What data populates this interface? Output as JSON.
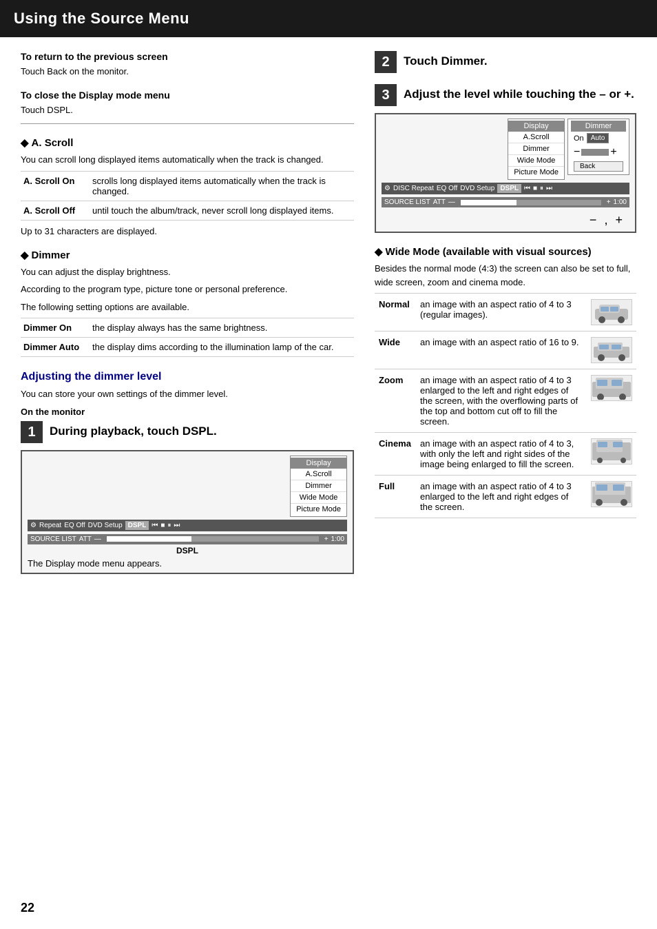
{
  "header": {
    "title": "Using the Source Menu"
  },
  "return_section": {
    "title": "To return to the previous screen",
    "body": "Touch Back on the monitor."
  },
  "close_section": {
    "title": "To close the Display mode menu",
    "body": "Touch DSPL."
  },
  "scroll_section": {
    "diamond_title": "A. Scroll",
    "body": "You can scroll long displayed items automatically when the track is changed.",
    "table": [
      {
        "term": "A. Scroll On",
        "definition": "scrolls long displayed items automatically when the track is changed."
      },
      {
        "term": "A. Scroll Off",
        "definition": "until touch the album/track, never scroll long displayed items."
      }
    ],
    "note": "Up to 31 characters are displayed."
  },
  "dimmer_section": {
    "diamond_title": "Dimmer",
    "body": "You can adjust the display brightness.",
    "body2": "According to the program type, picture tone or personal preference.",
    "body3": "The following setting options are available.",
    "table": [
      {
        "term": "Dimmer On",
        "definition": "the display always has the same brightness."
      },
      {
        "term": "Dimmer Auto",
        "definition": "the display dims according to the illumination lamp of the car."
      }
    ]
  },
  "adjusting_section": {
    "title": "Adjusting the dimmer level",
    "body": "You can store your own settings of the dimmer level.",
    "on_monitor_label": "On the monitor",
    "step1": {
      "num": "1",
      "instruction": "During playback, touch DSPL.",
      "dspl_label": "DSPL",
      "display_text": "The Display mode menu appears."
    },
    "step2": {
      "num": "2",
      "instruction": "Touch Dimmer."
    },
    "step3": {
      "num": "3",
      "instruction": "Adjust the level while touching the – or +.",
      "or_text": "or"
    }
  },
  "monitor_mockup": {
    "menu_title": "Display",
    "menu_items": [
      "A.Scroll",
      "Dimmer",
      "Wide Mode",
      "Picture Mode"
    ],
    "bottom_items": [
      "※",
      "Repeat",
      "EQ Off",
      "DVD Setup",
      "DSPL",
      "⏮",
      "■",
      "⏸",
      "⏭"
    ],
    "source_label": "SOURCE LIST",
    "att_label": "ATT",
    "time_label": "1:00"
  },
  "dimmer_panel": {
    "title": "Dimmer",
    "on_label": "On",
    "auto_label": "Auto",
    "back_label": "Back",
    "minus_label": "−",
    "plus_label": "+"
  },
  "wide_mode_section": {
    "diamond_title": "Wide Mode (available with visual sources)",
    "body": "Besides the normal mode (4:3) the screen can also be set to full, wide screen, zoom and cinema mode.",
    "table": [
      {
        "term": "Normal",
        "definition": "an image with an aspect ratio of 4 to 3 (regular images)."
      },
      {
        "term": "Wide",
        "definition": "an image with an aspect ratio of 16 to 9."
      },
      {
        "term": "Zoom",
        "definition": "an image with an aspect ratio of 4 to 3 enlarged to the left and right edges of the screen, with the overflowing parts of the top and bottom cut off to fill the screen."
      },
      {
        "term": "Cinema",
        "definition": "an image with an aspect ratio of 4 to 3, with only the left and right sides of the image being enlarged to fill the screen."
      },
      {
        "term": "Full",
        "definition": "an image with an aspect ratio of 4 to 3 enlarged to the left and right edges of the screen."
      }
    ]
  },
  "page_number": "22"
}
